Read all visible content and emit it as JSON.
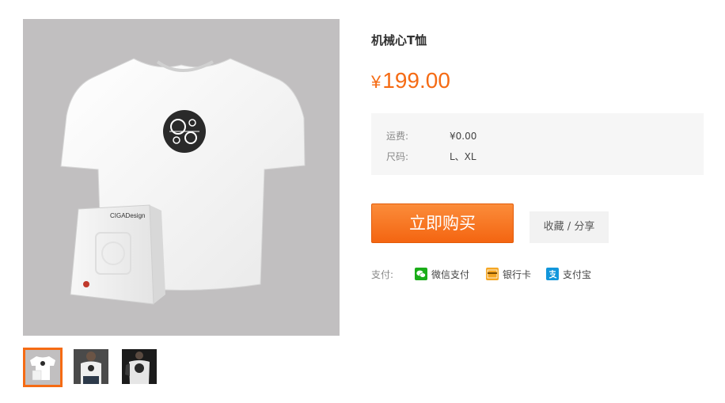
{
  "product": {
    "title": "机械心T恤",
    "price_symbol": "¥",
    "price": "199.00"
  },
  "specs": [
    {
      "label": "运费:",
      "value": "¥0.00"
    },
    {
      "label": "尺码:",
      "value": "L、XL"
    }
  ],
  "actions": {
    "buy_label": "立即购买",
    "favorite_share_label": "收藏 / 分享"
  },
  "payment": {
    "label": "支付:",
    "methods": [
      {
        "name": "微信支付",
        "icon": "wechat-pay-icon",
        "color": "#1aad19"
      },
      {
        "name": "银行卡",
        "icon": "bank-card-icon",
        "color": "#f5a623"
      },
      {
        "name": "支付宝",
        "icon": "alipay-icon",
        "color": "#1296db"
      }
    ]
  },
  "gallery": {
    "box_brand": "CIGADesign",
    "thumbnails": [
      "tshirt-with-box",
      "model-front",
      "model-dark"
    ],
    "active_index": 0
  },
  "colors": {
    "accent": "#f56b14",
    "image_bg": "#c1bfc0"
  }
}
